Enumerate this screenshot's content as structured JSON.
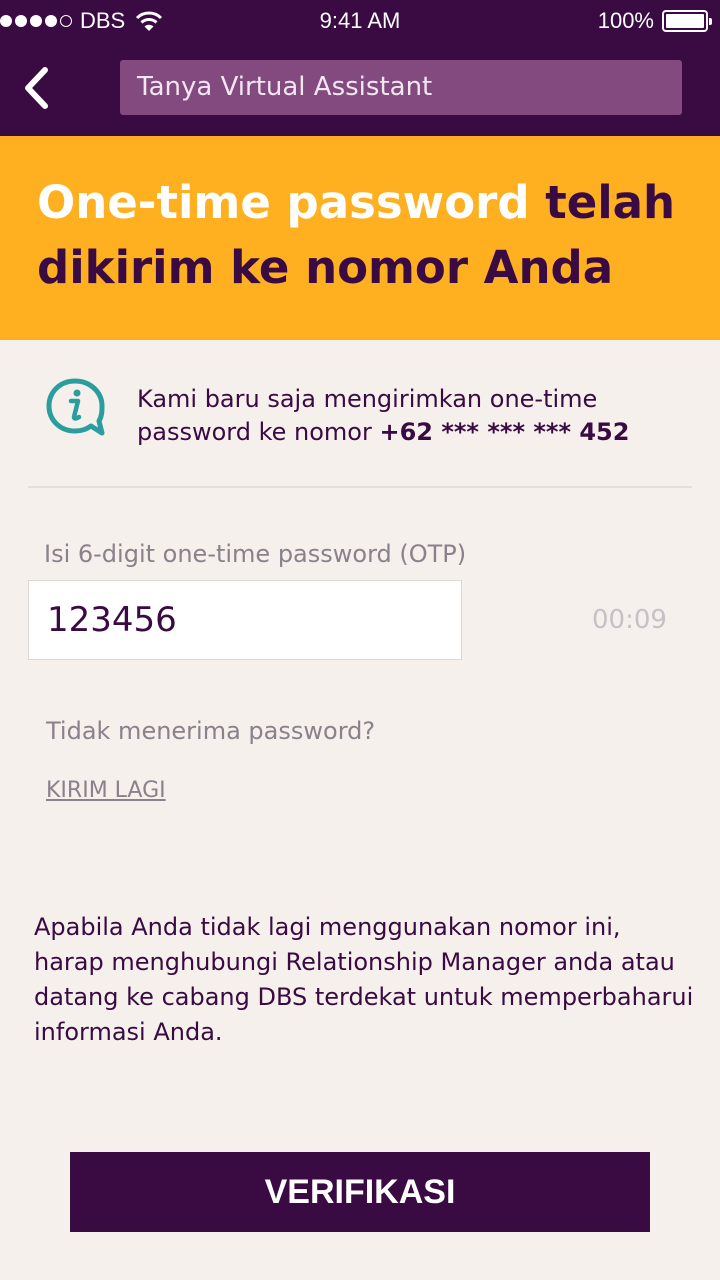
{
  "status_bar": {
    "carrier": "DBS",
    "time": "9:41 AM",
    "battery": "100%"
  },
  "header": {
    "search_placeholder": "Tanya Virtual Assistant"
  },
  "banner": {
    "title_highlight": "One-time password",
    "title_rest": " telah dikirim ke nomor Anda"
  },
  "info": {
    "text": "Kami baru saja mengirimkan one-time password ke nomor ",
    "phone": "+62 *** *** *** 452"
  },
  "otp": {
    "label": "Isi 6-digit one-time password (OTP)",
    "value": "123456",
    "timer": "00:09"
  },
  "resend": {
    "question": "Tidak menerima password?",
    "link": "KIRIM LAGI"
  },
  "note": "Apabila Anda tidak lagi menggunakan nomor ini, harap menghubungi Relationship Manager anda atau datang ke cabang DBS terdekat untuk memperbaharui informasi Anda.",
  "verify_button": "VERIFIKASI",
  "colors": {
    "brand_purple": "#3a0a42",
    "banner_yellow": "#feb021",
    "info_teal": "#2a9d9f",
    "background": "#f5f0eb"
  }
}
